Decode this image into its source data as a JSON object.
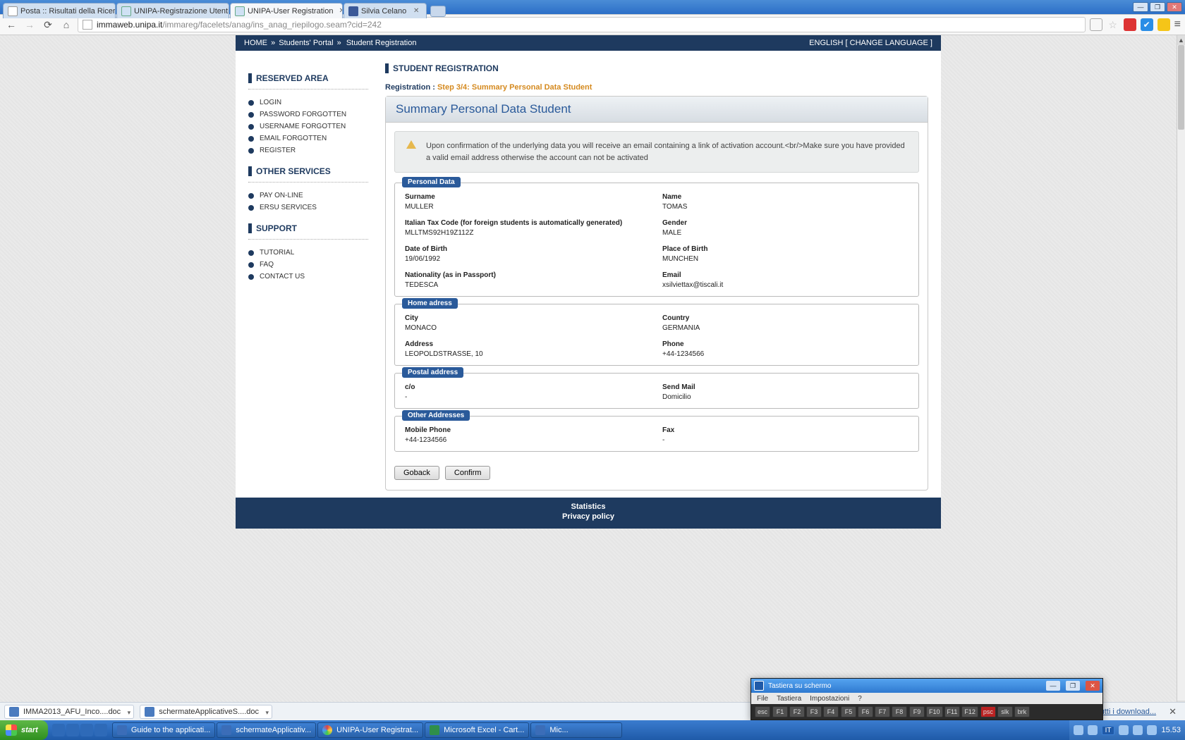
{
  "window": {
    "tabs": [
      {
        "title": "Posta :: Risultati della Ricerc"
      },
      {
        "title": "UNIPA-Registrazione Utenti"
      },
      {
        "title": "UNIPA-User Registration"
      },
      {
        "title": "Silvia Celano"
      }
    ]
  },
  "toolbar": {
    "url_host": "immaweb.unipa.it",
    "url_path": "/immareg/facelets/anag/ins_anag_riepilogo.seam?cid=242"
  },
  "topbar": {
    "home": "HOME",
    "portal": "Students' Portal",
    "page": "Student Registration",
    "language": "ENGLISH [ CHANGE LANGUAGE ]"
  },
  "sidebar": {
    "sections": [
      {
        "heading": "RESERVED AREA",
        "items": [
          "LOGIN",
          "PASSWORD FORGOTTEN",
          "USERNAME FORGOTTEN",
          "EMAIL FORGOTTEN",
          "REGISTER"
        ]
      },
      {
        "heading": "OTHER SERVICES",
        "items": [
          "PAY ON-LINE",
          "ERSU SERVICES"
        ]
      },
      {
        "heading": "SUPPORT",
        "items": [
          "TUTORIAL",
          "FAQ",
          "CONTACT US"
        ]
      }
    ]
  },
  "main": {
    "heading": "STUDENT REGISTRATION",
    "reg_label": "Registration :",
    "reg_step": "Step 3/4: Summary Personal Data Student",
    "panel_title": "Summary Personal Data Student",
    "notice": "Upon confirmation of the underlying data you will receive an email containing a link of activation account.<br/>Make sure you have provided a valid email address otherwise the account can not be activated",
    "groups": {
      "personal": {
        "legend": "Personal Data",
        "fields": [
          {
            "label": "Surname",
            "value": "MULLER"
          },
          {
            "label": "Name",
            "value": "TOMAS"
          },
          {
            "label": "Italian Tax Code (for foreign students is automatically generated)",
            "value": "MLLTMS92H19Z112Z"
          },
          {
            "label": "Gender",
            "value": "MALE"
          },
          {
            "label": "Date of Birth",
            "value": "19/06/1992"
          },
          {
            "label": "Place of Birth",
            "value": "MUNCHEN"
          },
          {
            "label": "Nationality (as in Passport)",
            "value": "TEDESCA"
          },
          {
            "label": "Email",
            "value": "xsilviettax@tiscali.it"
          }
        ]
      },
      "home": {
        "legend": "Home adress",
        "fields": [
          {
            "label": "City",
            "value": "MONACO"
          },
          {
            "label": "Country",
            "value": "GERMANIA"
          },
          {
            "label": "Address",
            "value": "LEOPOLDSTRASSE, 10"
          },
          {
            "label": "Phone",
            "value": "+44-1234566"
          }
        ]
      },
      "postal": {
        "legend": "Postal address",
        "fields": [
          {
            "label": "c/o",
            "value": "-"
          },
          {
            "label": "Send Mail",
            "value": "Domicilio"
          }
        ]
      },
      "other": {
        "legend": "Other Addresses",
        "fields": [
          {
            "label": "Mobile Phone",
            "value": "+44-1234566"
          },
          {
            "label": "Fax",
            "value": "-"
          }
        ]
      }
    },
    "buttons": {
      "back": "Goback",
      "confirm": "Confirm"
    }
  },
  "footer": {
    "stats": "Statistics",
    "privacy": "Privacy policy"
  },
  "docbar": {
    "docs": [
      "IMMA2013_AFU_Inco....doc",
      "schermateApplicativeS....doc"
    ],
    "dl_link": "ra tutti i download..."
  },
  "taskbar": {
    "start": "start",
    "tasks": [
      {
        "cls": "word",
        "label": "Guide to the applicati..."
      },
      {
        "cls": "word",
        "label": "schermateApplicativ..."
      },
      {
        "cls": "chrome",
        "label": "UNIPA-User Registrat..."
      },
      {
        "cls": "excel",
        "label": "Microsoft Excel - Cart..."
      },
      {
        "cls": "word",
        "label": "Mic..."
      }
    ],
    "lang": "IT",
    "clock": "15.53"
  },
  "osk": {
    "title": "Tastiera su schermo",
    "menu": [
      "File",
      "Tastiera",
      "Impostazioni",
      "?"
    ],
    "row": [
      "esc",
      "F1",
      "F2",
      "F3",
      "F4",
      "F5",
      "F6",
      "F7",
      "F8",
      "F9",
      "F10",
      "F11",
      "F12",
      "psc",
      "slk",
      "brk"
    ]
  }
}
